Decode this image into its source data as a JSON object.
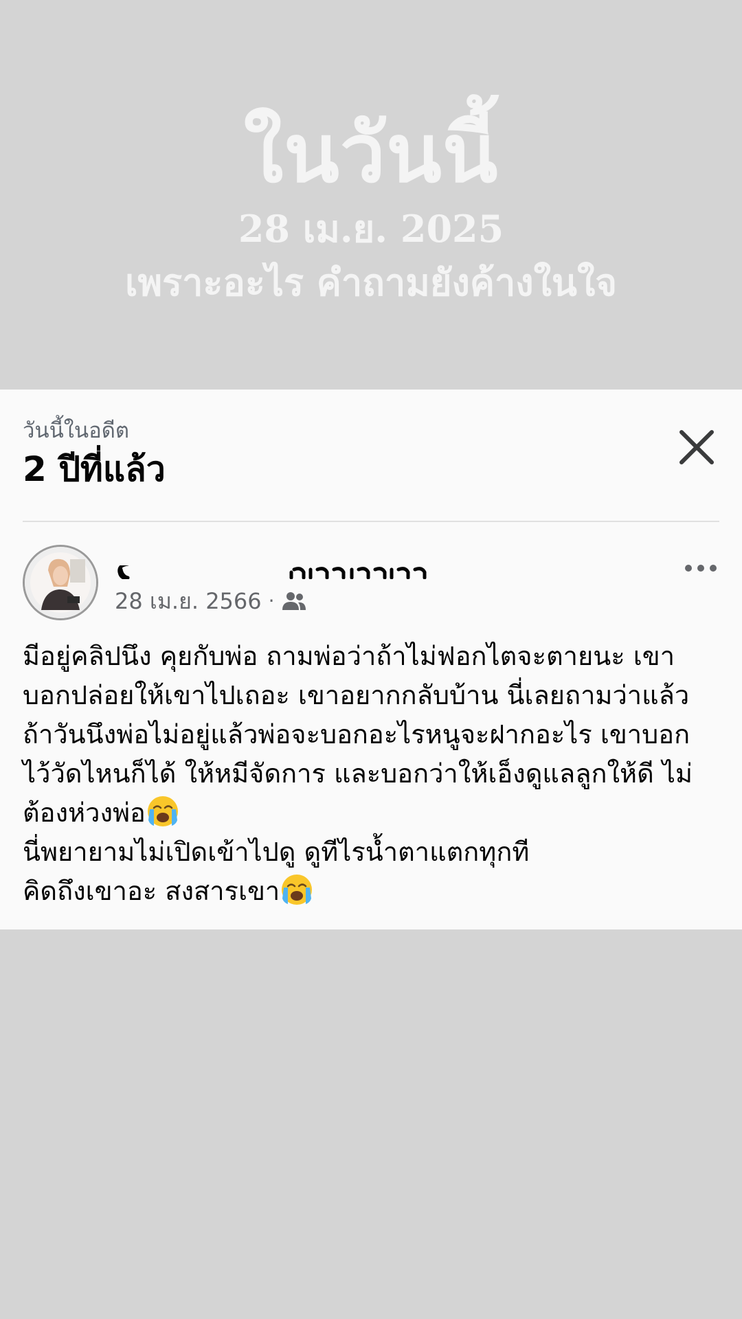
{
  "overlay": {
    "title": "ในวันนี้",
    "date": "28 เม.ย. 2025",
    "caption": "เพราะอะไร คำถามยังค้างในใจ"
  },
  "memory_card": {
    "subtitle": "วันนี้ในอดีต",
    "title": "2 ปีที่แล้ว",
    "close_icon": "close-icon"
  },
  "post": {
    "date": "28 เม.ย. 2566",
    "separator": "·",
    "audience_icon": "friends-icon",
    "more_icon": "more-options-icon",
    "lines": [
      "มีอยู่คลิปนึง คุยกับพ่อ ถามพ่อว่าถ้าไม่ฟอกไตจะตายนะ เขา",
      "บอกปล่อยให้เขาไปเถอะ เขาอยากกลับบ้าน นี่เลยถามว่าแล้ว",
      "ถ้าวันนึงพ่อไม่อยู่แล้วพ่อจะบอกอะไรหนูจะฝากอะไร เขาบอก",
      "ไว้วัดไหนก็ได้ ให้หมีจัดการ และบอกว่าให้เอ็งดูแลลูกให้ดี ไม่",
      "ต้องห่วงพ่อ",
      "นี่พยายามไม่เปิดเข้าไปดู ดูทีไรน้ำตาแตกทุกที",
      "คิดถึงเขาอะ สงสารเขา"
    ],
    "emoji": "loudly-crying-face"
  }
}
